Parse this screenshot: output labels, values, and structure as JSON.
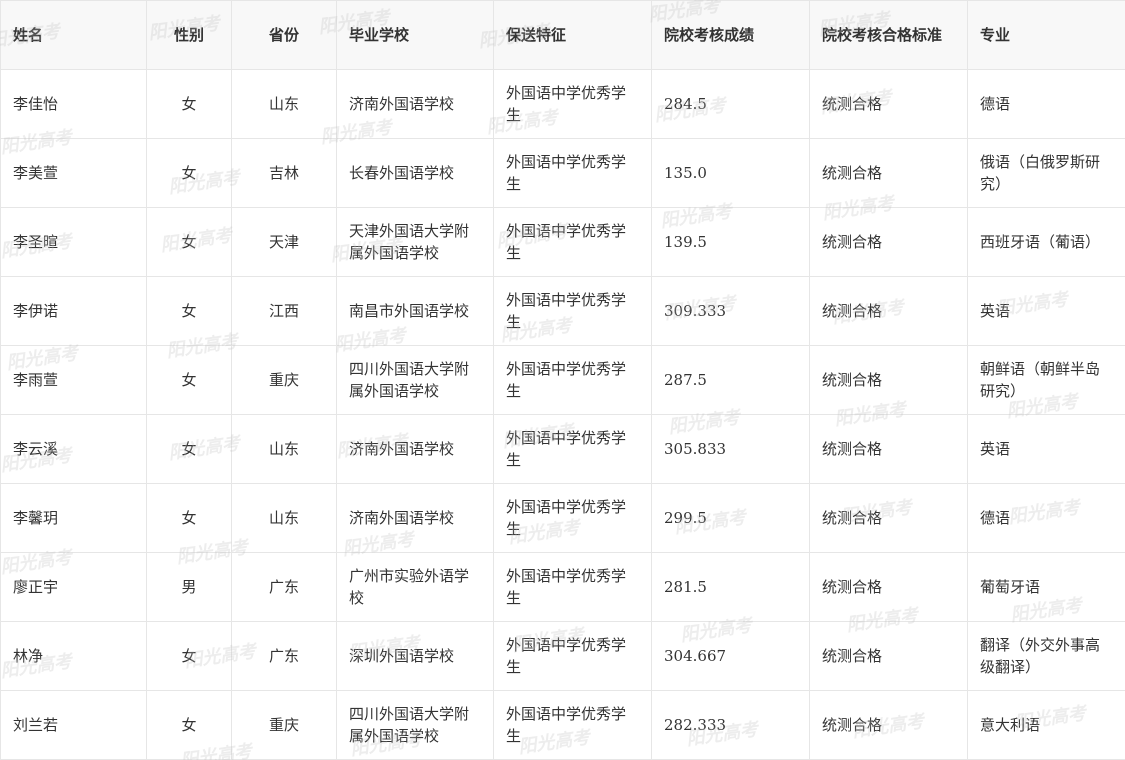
{
  "table": {
    "headers": [
      "姓名",
      "性别",
      "省份",
      "毕业学校",
      "保送特征",
      "院校考核成绩",
      "院校考核合格标准",
      "专业"
    ],
    "rows": [
      [
        "李佳怡",
        "女",
        "山东",
        "济南外国语学校",
        "外国语中学优秀学生",
        "284.5",
        "统测合格",
        "德语"
      ],
      [
        "李美萱",
        "女",
        "吉林",
        "长春外国语学校",
        "外国语中学优秀学生",
        "135.0",
        "统测合格",
        "俄语（白俄罗斯研究）"
      ],
      [
        "李圣暄",
        "女",
        "天津",
        "天津外国语大学附属外国语学校",
        "外国语中学优秀学生",
        "139.5",
        "统测合格",
        "西班牙语（葡语）"
      ],
      [
        "李伊诺",
        "女",
        "江西",
        "南昌市外国语学校",
        "外国语中学优秀学生",
        "309.333",
        "统测合格",
        "英语"
      ],
      [
        "李雨萱",
        "女",
        "重庆",
        "四川外国语大学附属外国语学校",
        "外国语中学优秀学生",
        "287.5",
        "统测合格",
        "朝鲜语（朝鲜半岛研究）"
      ],
      [
        "李云溪",
        "女",
        "山东",
        "济南外国语学校",
        "外国语中学优秀学生",
        "305.833",
        "统测合格",
        "英语"
      ],
      [
        "李馨玥",
        "女",
        "山东",
        "济南外国语学校",
        "外国语中学优秀学生",
        "299.5",
        "统测合格",
        "德语"
      ],
      [
        "廖正宇",
        "男",
        "广东",
        "广州市实验外语学校",
        "外国语中学优秀学生",
        "281.5",
        "统测合格",
        "葡萄牙语"
      ],
      [
        "林净",
        "女",
        "广东",
        "深圳外国语学校",
        "外国语中学优秀学生",
        "304.667",
        "统测合格",
        "翻译（外交外事高级翻译）"
      ],
      [
        "刘兰若",
        "女",
        "重庆",
        "四川外国语大学附属外国语学校",
        "外国语中学优秀学生",
        "282.333",
        "统测合格",
        "意大利语"
      ]
    ]
  },
  "watermark": {
    "text": "阳光高考",
    "color": "#bebebe"
  }
}
